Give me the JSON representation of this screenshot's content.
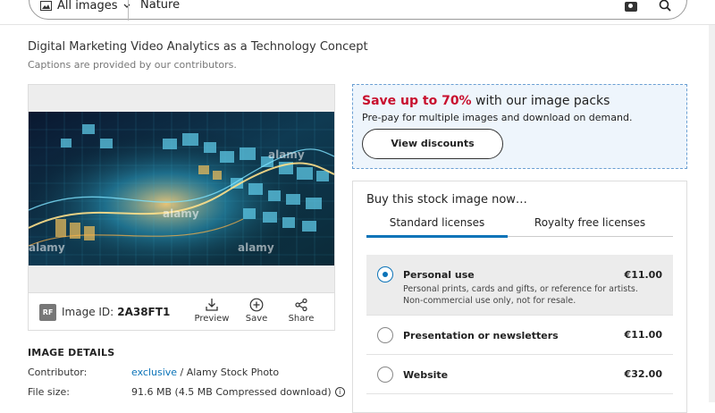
{
  "search": {
    "type_label": "All images",
    "query": "Nature"
  },
  "image": {
    "title": "Digital Marketing Video Analytics as a Technology Concept",
    "caption_note": "Captions are provided by our contributors.",
    "license_badge": "RF",
    "id_label": "Image ID:",
    "id_value": "2A38FT1",
    "watermark": "alamy"
  },
  "toolbar": {
    "preview": "Preview",
    "save": "Save",
    "share": "Share"
  },
  "details": {
    "heading": "IMAGE DETAILS",
    "contributor_label": "Contributor:",
    "contributor_link": "exclusive",
    "contributor_rest": " / Alamy Stock Photo",
    "filesize_label": "File size:",
    "filesize_value": "91.6 MB (4.5 MB Compressed download)"
  },
  "promo": {
    "headline_hot": "Save up to 70%",
    "headline_rest": " with our image packs",
    "sub": "Pre-pay for multiple images and download on demand.",
    "button": "View discounts"
  },
  "buy": {
    "heading": "Buy this stock image now…",
    "tabs": [
      "Standard licenses",
      "Royalty free licenses"
    ],
    "options": [
      {
        "title": "Personal use",
        "price": "€11.00",
        "desc1": "Personal prints, cards and gifts, or reference for artists.",
        "desc2": "Non-commercial use only, not for resale.",
        "selected": true
      },
      {
        "title": "Presentation or newsletters",
        "price": "€11.00"
      },
      {
        "title": "Website",
        "price": "€32.00"
      }
    ]
  },
  "colors": {
    "accent": "#0b73b8",
    "sale": "#c8102e",
    "promo_bg": "#eef5fc"
  }
}
